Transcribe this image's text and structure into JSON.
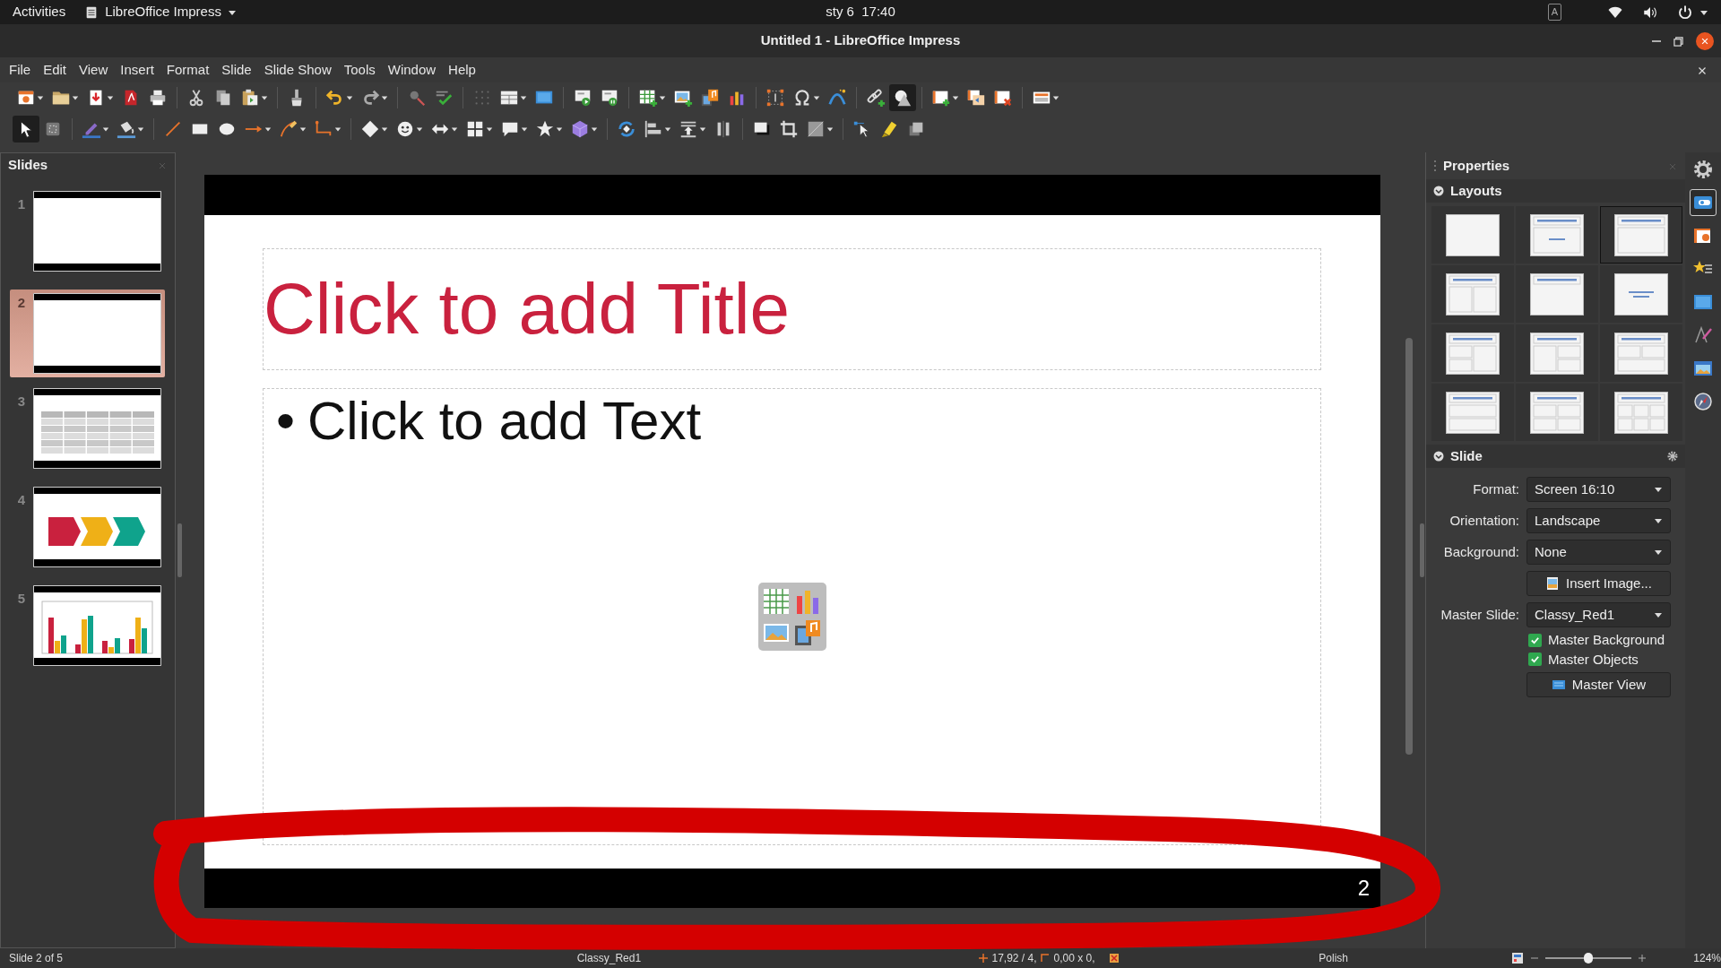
{
  "top_bar": {
    "activities": "Activities",
    "app_menu": "LibreOffice Impress",
    "clock": "sty 6  17:40",
    "input_source": "A"
  },
  "window": {
    "title": "Untitled 1 - LibreOffice Impress"
  },
  "menu": [
    "File",
    "Edit",
    "View",
    "Insert",
    "Format",
    "Slide",
    "Slide Show",
    "Tools",
    "Window",
    "Help"
  ],
  "toolbars": [
    [
      [
        {
          "kind": "new",
          "dropdown": true,
          "selected": false
        },
        {
          "kind": "open",
          "dropdown": true,
          "selected": false
        },
        {
          "kind": "export",
          "dropdown": true,
          "selected": false
        },
        {
          "kind": "pdf",
          "dropdown": false,
          "selected": false
        },
        {
          "kind": "print",
          "dropdown": false,
          "selected": false
        }
      ],
      [
        {
          "kind": "cut",
          "dropdown": false,
          "selected": false
        },
        {
          "kind": "copy",
          "dropdown": false,
          "selected": false
        },
        {
          "kind": "paste",
          "dropdown": true,
          "selected": false
        }
      ],
      [
        {
          "kind": "clone",
          "dropdown": false,
          "selected": false
        }
      ],
      [
        {
          "kind": "undo",
          "dropdown": true,
          "selected": false
        },
        {
          "kind": "redo",
          "dropdown": true,
          "selected": false
        }
      ],
      [
        {
          "kind": "find",
          "dropdown": false,
          "selected": false
        },
        {
          "kind": "spell",
          "dropdown": false,
          "selected": false
        }
      ],
      [
        {
          "kind": "grid",
          "dropdown": false,
          "selected": false
        },
        {
          "kind": "views",
          "dropdown": true,
          "selected": false
        },
        {
          "kind": "master",
          "dropdown": false,
          "selected": false
        }
      ],
      [
        {
          "kind": "show_first",
          "dropdown": false,
          "selected": false
        },
        {
          "kind": "show_current",
          "dropdown": false,
          "selected": false
        }
      ],
      [
        {
          "kind": "table",
          "dropdown": true,
          "selected": false
        },
        {
          "kind": "image",
          "dropdown": false,
          "selected": false
        },
        {
          "kind": "media",
          "dropdown": false,
          "selected": false
        },
        {
          "kind": "chart",
          "dropdown": false,
          "selected": false
        }
      ],
      [
        {
          "kind": "textbox",
          "dropdown": false,
          "selected": false
        },
        {
          "kind": "special",
          "dropdown": true,
          "selected": false
        },
        {
          "kind": "fontwork",
          "dropdown": false,
          "selected": false
        }
      ],
      [
        {
          "kind": "link",
          "dropdown": false,
          "selected": false
        },
        {
          "kind": "shapes",
          "dropdown": false,
          "selected": true
        }
      ],
      [
        {
          "kind": "new_slide",
          "dropdown": true,
          "selected": false
        },
        {
          "kind": "duplicate_slide",
          "dropdown": false,
          "selected": false
        },
        {
          "kind": "delete_slide",
          "dropdown": false,
          "selected": false
        }
      ],
      [
        {
          "kind": "layout",
          "dropdown": true,
          "selected": false
        }
      ]
    ],
    [
      [
        {
          "kind": "select",
          "dropdown": false,
          "selected": true
        },
        {
          "kind": "zoom_pan",
          "dropdown": false,
          "selected": false
        }
      ],
      [
        {
          "kind": "line_color",
          "dropdown": true,
          "selected": false
        },
        {
          "kind": "fill_color",
          "dropdown": true,
          "selected": false
        }
      ],
      [
        {
          "kind": "line",
          "dropdown": false,
          "selected": false
        },
        {
          "kind": "rect",
          "dropdown": false,
          "selected": false
        },
        {
          "kind": "ellipse",
          "dropdown": false,
          "selected": false
        },
        {
          "kind": "arrow_line",
          "dropdown": true,
          "selected": false
        },
        {
          "kind": "curve",
          "dropdown": true,
          "selected": false
        },
        {
          "kind": "connector",
          "dropdown": true,
          "selected": false
        }
      ],
      [
        {
          "kind": "diamond",
          "dropdown": true,
          "selected": false
        },
        {
          "kind": "smiley",
          "dropdown": true,
          "selected": false
        },
        {
          "kind": "double_arrow",
          "dropdown": true,
          "selected": false
        },
        {
          "kind": "flowchart",
          "dropdown": true,
          "selected": false
        },
        {
          "kind": "callout",
          "dropdown": true,
          "selected": false
        },
        {
          "kind": "star",
          "dropdown": true,
          "selected": false
        },
        {
          "kind": "cube",
          "dropdown": true,
          "selected": false
        }
      ],
      [
        {
          "kind": "rotate",
          "dropdown": false,
          "selected": false
        },
        {
          "kind": "align",
          "dropdown": true,
          "selected": false
        },
        {
          "kind": "arrange",
          "dropdown": true,
          "selected": false
        },
        {
          "kind": "distribute",
          "dropdown": false,
          "selected": false
        }
      ],
      [
        {
          "kind": "shadow",
          "dropdown": false,
          "selected": false
        },
        {
          "kind": "crop",
          "dropdown": false,
          "selected": false
        },
        {
          "kind": "filter",
          "dropdown": true,
          "selected": false
        }
      ],
      [
        {
          "kind": "points",
          "dropdown": false,
          "selected": false
        },
        {
          "kind": "glue",
          "dropdown": false,
          "selected": false
        },
        {
          "kind": "toggle3d",
          "dropdown": false,
          "selected": false
        }
      ]
    ]
  ],
  "slides_pane": {
    "title": "Slides",
    "slides": [
      {
        "number": "1",
        "kind": "blank",
        "selected": false
      },
      {
        "number": "2",
        "kind": "blank",
        "selected": true
      },
      {
        "number": "3",
        "kind": "table",
        "selected": false
      },
      {
        "number": "4",
        "kind": "process_arrows",
        "selected": false
      },
      {
        "number": "5",
        "kind": "bar_chart",
        "selected": false
      }
    ]
  },
  "slide": {
    "title_placeholder": "Click to add Title",
    "body_placeholder": {
      "bullet": "•",
      "text": "Click to add Text"
    },
    "page_number": "2"
  },
  "properties": {
    "title": "Properties",
    "layouts": {
      "title": "Layouts",
      "expanded": true,
      "items": [
        {
          "kind": "blank",
          "selected": false
        },
        {
          "kind": "title_subtitle",
          "selected": false
        },
        {
          "kind": "title_content",
          "selected": true
        },
        {
          "kind": "title_2col",
          "selected": false
        },
        {
          "kind": "title_only",
          "selected": false
        },
        {
          "kind": "centered_text",
          "selected": false
        },
        {
          "kind": "title_2_1",
          "selected": false
        },
        {
          "kind": "title_1_2",
          "selected": false
        },
        {
          "kind": "title_2top_1bottom",
          "selected": false
        },
        {
          "kind": "title_stacked",
          "selected": false
        },
        {
          "kind": "title_4",
          "selected": false
        },
        {
          "kind": "title_6",
          "selected": false
        }
      ]
    },
    "slide_section": {
      "title": "Slide",
      "expanded": true,
      "controls": [
        {
          "kind": "select",
          "label": "Format:",
          "value": "Screen 16:10"
        },
        {
          "kind": "select",
          "label": "Orientation:",
          "value": "Landscape"
        },
        {
          "kind": "select",
          "label": "Background:",
          "value": "None"
        },
        {
          "kind": "image_button",
          "text": "Insert Image..."
        },
        {
          "kind": "select",
          "label": "Master Slide:",
          "value": "Classy_Red1"
        },
        {
          "kind": "check",
          "text": "Master Background",
          "checked": true
        },
        {
          "kind": "check",
          "text": "Master Objects",
          "checked": true
        },
        {
          "kind": "view_button",
          "text": "Master View"
        }
      ]
    }
  },
  "sidebar_tabs": [
    {
      "kind": "settings",
      "selected": false
    },
    {
      "kind": "properties",
      "selected": true
    },
    {
      "kind": "slide_transition",
      "selected": false
    },
    {
      "kind": "animation",
      "selected": false
    },
    {
      "kind": "master_slides",
      "selected": false
    },
    {
      "kind": "styles",
      "selected": false
    },
    {
      "kind": "gallery",
      "selected": false
    },
    {
      "kind": "navigator",
      "selected": false
    }
  ],
  "status_bar": {
    "slide": "Slide 2 of 5",
    "master": "Classy_Red1",
    "position": "17,92 / 4,",
    "size": "0,00 x 0,",
    "language": "Polish",
    "zoom": {
      "level": 0.5
    },
    "zoom_percent": "124%"
  }
}
